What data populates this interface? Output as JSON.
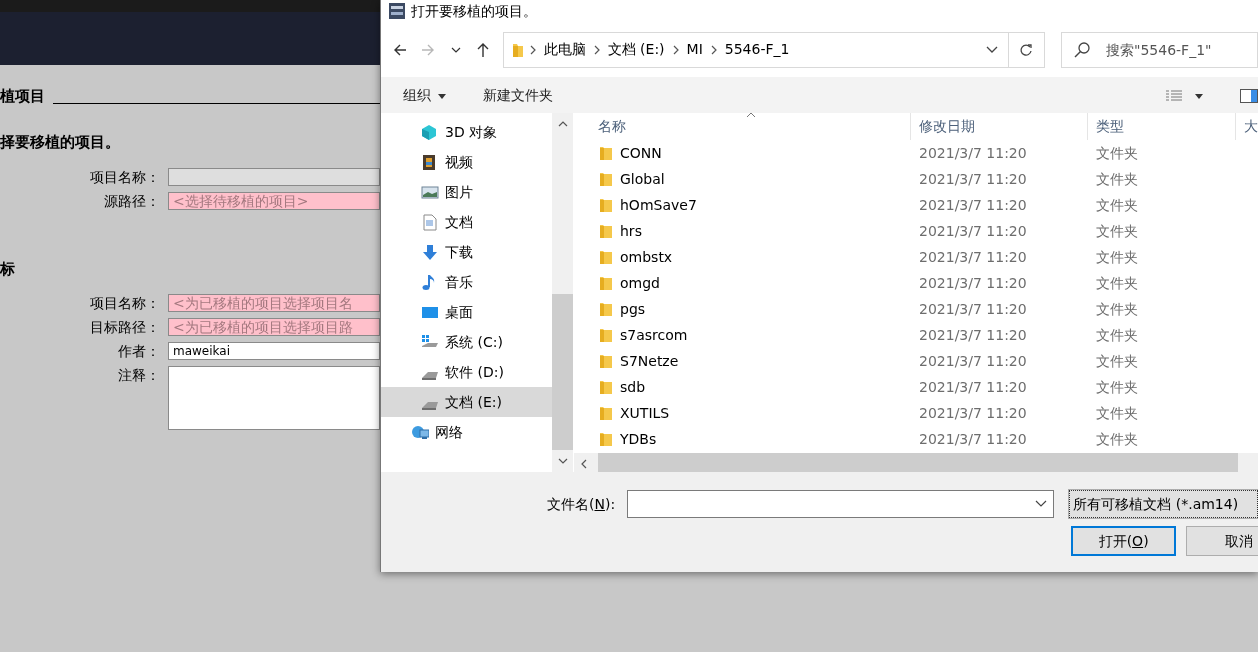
{
  "background_app": {
    "heading": "植项目",
    "sections": [
      {
        "heading": "择要移植的项目。",
        "fields": [
          {
            "label": "项目名称：",
            "kind": "disabled"
          },
          {
            "label": "源路径：",
            "kind": "required",
            "value": "<选择待移植的项目>"
          }
        ]
      },
      {
        "heading": "标",
        "fields": [
          {
            "label": "项目名称：",
            "kind": "required",
            "value": "<为已移植的项目选择项目名"
          },
          {
            "label": "目标路径：",
            "kind": "required",
            "value": "<为已移植的项目选择项目路"
          },
          {
            "label": "作者：",
            "kind": "text",
            "value": "maweikai"
          },
          {
            "label": "注释：",
            "kind": "multiline"
          }
        ]
      }
    ]
  },
  "dialog": {
    "title": "打开要移植的项目。",
    "nav_buttons": [
      {
        "kind": "back",
        "disabled": false
      },
      {
        "kind": "forward",
        "disabled": true
      },
      {
        "kind": "recent",
        "disabled": false
      },
      {
        "kind": "up",
        "disabled": false
      }
    ],
    "breadcrumb": [
      "此电脑",
      "文档 (E:)",
      "MI",
      "5546-F_1"
    ],
    "search": {
      "placeholder": "搜索\"5546-F_1\""
    },
    "toolbar": [
      {
        "label": "组织",
        "kind": "menu"
      },
      {
        "label": "新建文件夹",
        "kind": "button"
      }
    ],
    "nav_tree": [
      {
        "children": [
          {
            "label": "3D 对象",
            "kind": "cube",
            "selected": false
          },
          {
            "label": "视频",
            "kind": "video",
            "selected": false
          },
          {
            "label": "图片",
            "kind": "picture",
            "selected": false
          },
          {
            "label": "文档",
            "kind": "document",
            "selected": false
          },
          {
            "label": "下载",
            "kind": "download",
            "selected": false
          },
          {
            "label": "音乐",
            "kind": "music",
            "selected": false
          },
          {
            "label": "桌面",
            "kind": "desktop",
            "selected": false
          },
          {
            "label": "系统 (C:)",
            "kind": "system-drive",
            "selected": false
          },
          {
            "label": "软件 (D:)",
            "kind": "drive",
            "selected": false
          },
          {
            "label": "文档 (E:)",
            "kind": "drive",
            "selected": true
          }
        ]
      },
      {
        "label": "网络",
        "kind": "network",
        "selected": false
      }
    ],
    "columns": [
      "名称",
      "修改日期",
      "类型",
      "大"
    ],
    "files": [
      {
        "name": "CONN",
        "modified": "2021/3/7 11:20",
        "type": "文件夹"
      },
      {
        "name": "Global",
        "modified": "2021/3/7 11:20",
        "type": "文件夹"
      },
      {
        "name": "hOmSave7",
        "modified": "2021/3/7 11:20",
        "type": "文件夹"
      },
      {
        "name": "hrs",
        "modified": "2021/3/7 11:20",
        "type": "文件夹"
      },
      {
        "name": "ombstx",
        "modified": "2021/3/7 11:20",
        "type": "文件夹"
      },
      {
        "name": "omgd",
        "modified": "2021/3/7 11:20",
        "type": "文件夹"
      },
      {
        "name": "pgs",
        "modified": "2021/3/7 11:20",
        "type": "文件夹"
      },
      {
        "name": "s7asrcom",
        "modified": "2021/3/7 11:20",
        "type": "文件夹"
      },
      {
        "name": "S7Netze",
        "modified": "2021/3/7 11:20",
        "type": "文件夹"
      },
      {
        "name": "sdb",
        "modified": "2021/3/7 11:20",
        "type": "文件夹"
      },
      {
        "name": "XUTILS",
        "modified": "2021/3/7 11:20",
        "type": "文件夹"
      },
      {
        "name": "YDBs",
        "modified": "2021/3/7 11:20",
        "type": "文件夹"
      }
    ],
    "filename": {
      "label_parts": [
        "文件名(",
        "N",
        "):"
      ]
    },
    "filter": "所有可移植文档 (*.am14)",
    "buttons": [
      {
        "kind": "default",
        "parts": [
          "打开(",
          "O",
          ")"
        ]
      },
      {
        "kind": "normal",
        "parts": [
          "取消"
        ]
      }
    ]
  }
}
